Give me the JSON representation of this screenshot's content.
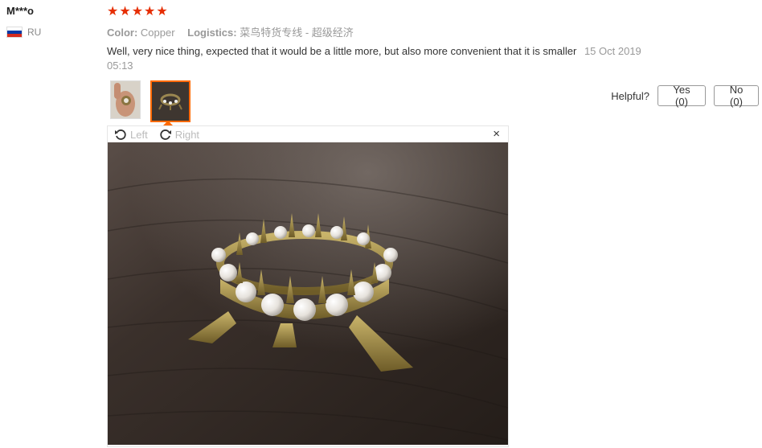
{
  "reviewer": {
    "name": "M***o",
    "country": "RU"
  },
  "rating": {
    "stars": 5,
    "max": 5
  },
  "attributes": {
    "color_label": "Color:",
    "color_value": "Copper",
    "logistics_label": "Logistics:",
    "logistics_value": "菜鸟特货专线 - 超级经济"
  },
  "review": {
    "text": "Well, very nice thing, expected that it would be a little more, but also more convenient that it is smaller",
    "date": "15 Oct 2019",
    "time": "05:13"
  },
  "helpful": {
    "label": "Helpful?",
    "yes": "Yes (0)",
    "no": "No (0)"
  },
  "viewer": {
    "rotate_left": "Left",
    "rotate_right": "Right",
    "close": "×"
  },
  "colors": {
    "star": "#e62e04",
    "accent": "#ff6a00"
  }
}
